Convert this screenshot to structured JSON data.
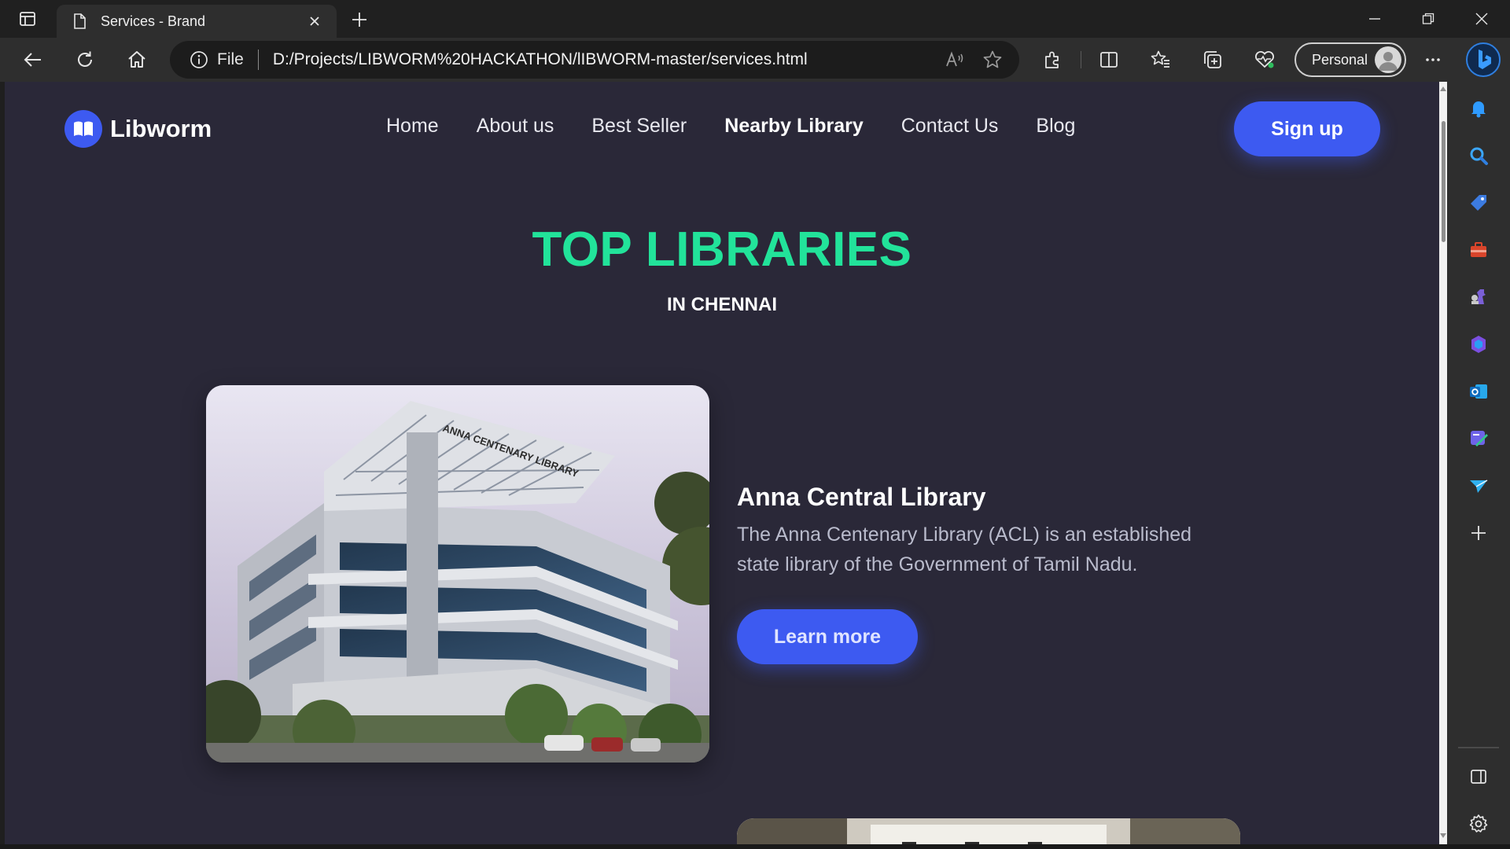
{
  "browser": {
    "tab": {
      "title": "Services - Brand"
    },
    "address": {
      "scheme_label": "File",
      "url": "D:/Projects/LIBWORM%20HACKATHON/lIBWORM-master/services.html"
    },
    "profile": {
      "name": "Personal"
    }
  },
  "site": {
    "brand": "Libworm",
    "nav": [
      {
        "label": "Home"
      },
      {
        "label": "About us"
      },
      {
        "label": "Best Seller"
      },
      {
        "label": "Nearby Library"
      },
      {
        "label": "Contact Us"
      },
      {
        "label": "Blog"
      }
    ],
    "active_nav": "Nearby Library",
    "signup_label": "Sign up",
    "hero": {
      "title": "TOP LIBRARIES",
      "subtitle": "IN CHENNAI"
    },
    "library": {
      "name": "Anna Central Library",
      "description": "The Anna Centenary Library (ACL) is an established state library of the Government of Tamil Nadu.",
      "cta_label": "Learn more",
      "photo_sign": "ANNA CENTENARY LIBRARY"
    }
  },
  "colors": {
    "page_bg": "#2a2838",
    "accent_blue": "#3d5af1",
    "title_green": "#22e39a"
  }
}
